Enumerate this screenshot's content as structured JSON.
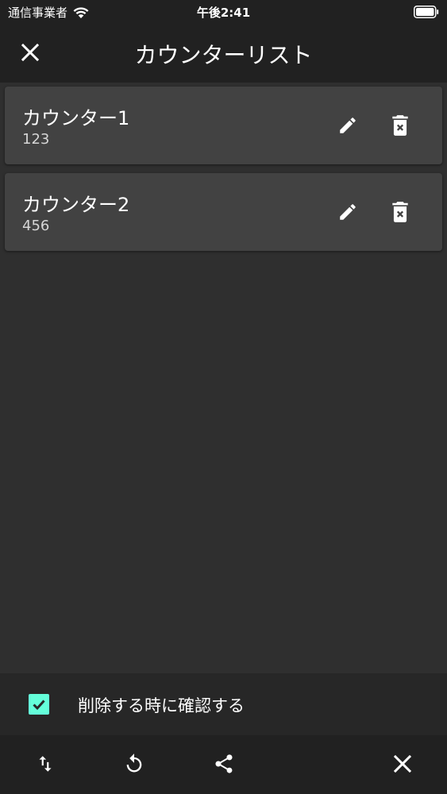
{
  "status_bar": {
    "carrier": "通信事業者",
    "time": "午後2:41"
  },
  "app_bar": {
    "title": "カウンターリスト"
  },
  "counters": [
    {
      "name": "カウンター1",
      "value": "123"
    },
    {
      "name": "カウンター2",
      "value": "456"
    }
  ],
  "confirm_option": {
    "label": "削除する時に確認する",
    "checked": true
  },
  "colors": {
    "accent": "#64ffda",
    "background": "#2f2f2f",
    "card": "#424242",
    "bar": "#212121"
  },
  "icons": {
    "close": "close-icon",
    "edit": "pencil-icon",
    "delete": "trash-can-icon",
    "sort": "swap-vertical-icon",
    "reset": "refresh-icon",
    "share": "share-icon"
  }
}
